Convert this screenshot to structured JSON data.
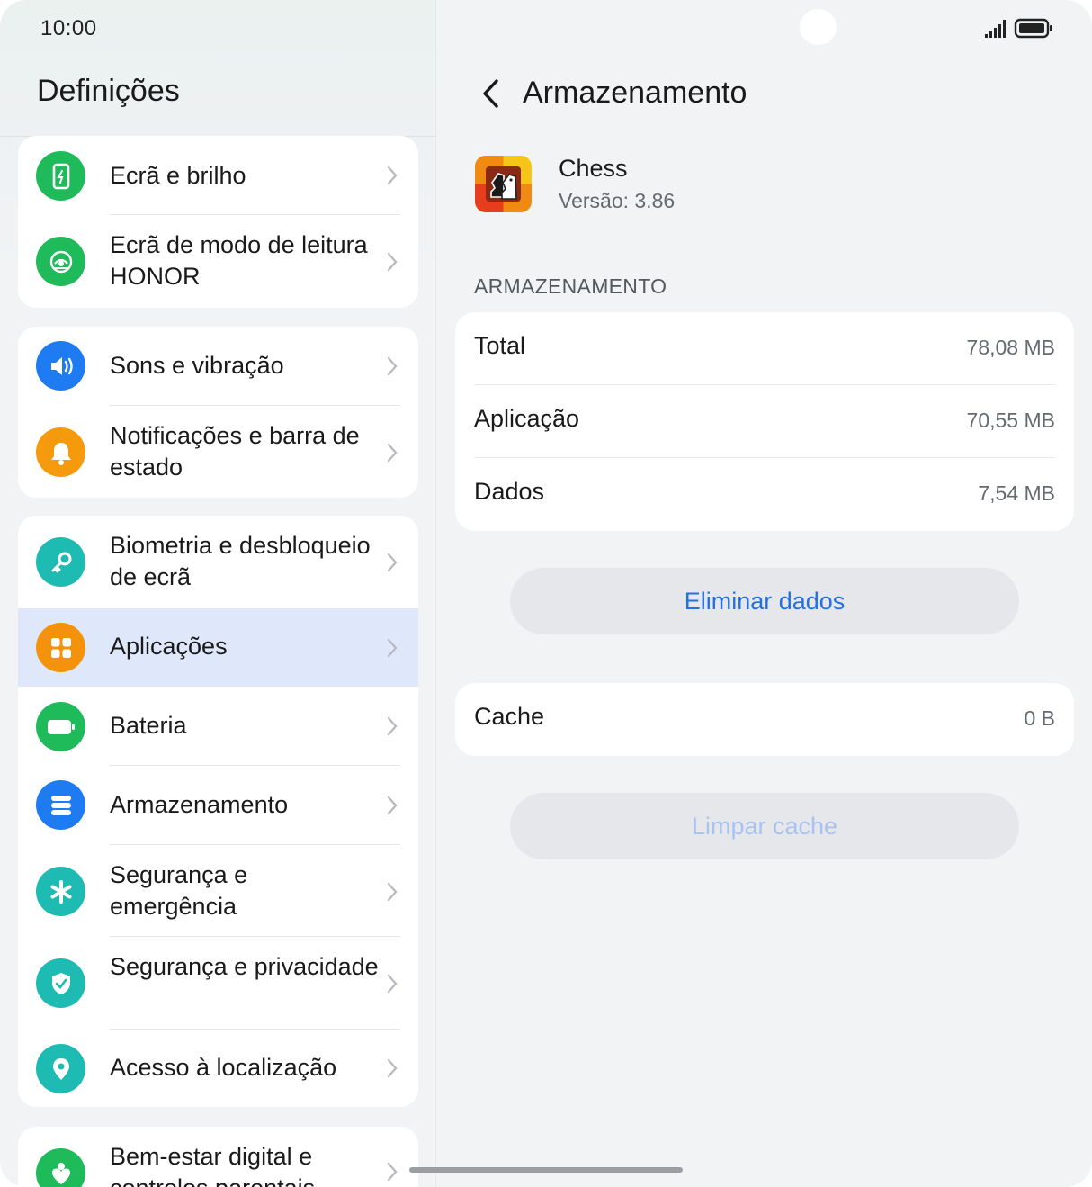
{
  "status_bar": {
    "time": "10:00",
    "signal_icon": "signal-icon",
    "battery_icon": "battery-icon"
  },
  "settings": {
    "title": "Definições",
    "items": [
      {
        "label": "Ecrã e brilho",
        "icon": "display-brightness-icon",
        "color": "#1fba5a"
      },
      {
        "label": "Ecrã de modo de leitura HONOR",
        "icon": "eye-comfort-icon",
        "color": "#1fba5a"
      },
      {
        "label": "Sons e vibração",
        "icon": "speaker-icon",
        "color": "#1f7bf2"
      },
      {
        "label": "Notificações e barra de estado",
        "icon": "bell-icon",
        "color": "#f59a0c"
      },
      {
        "label": "Biometria e desbloqueio de ecrã",
        "icon": "key-icon",
        "color": "#1dbbb2"
      },
      {
        "label": "Aplicações",
        "icon": "apps-grid-icon",
        "color": "#f5920c",
        "selected": true
      },
      {
        "label": "Bateria",
        "icon": "battery-setting-icon",
        "color": "#1fba5a"
      },
      {
        "label": "Armazenamento",
        "icon": "storage-icon",
        "color": "#1f7bf2"
      },
      {
        "label": "Segurança e emergência",
        "icon": "asterisk-icon",
        "color": "#1dbbb2"
      },
      {
        "label": "Segurança e privacidade",
        "icon": "shield-check-icon",
        "color": "#1dbbb2"
      },
      {
        "label": "Acesso à localização",
        "icon": "location-pin-icon",
        "color": "#1dbbb2"
      },
      {
        "label": "Bem-estar digital e controlos parentais",
        "icon": "heart-person-icon",
        "color": "#1fba5a"
      }
    ]
  },
  "detail": {
    "back_icon": "back-arrow-icon",
    "title": "Armazenamento",
    "app": {
      "name": "Chess",
      "version": "Versão: 3.86",
      "icon": "chess-app-icon"
    },
    "section_header": "ARMAZENAMENTO",
    "storage_rows": [
      {
        "label": "Total",
        "value": "78,08 MB"
      },
      {
        "label": "Aplicação",
        "value": "70,55 MB"
      },
      {
        "label": "Dados",
        "value": "7,54 MB"
      }
    ],
    "clear_data_label": "Eliminar dados",
    "cache": {
      "label": "Cache",
      "value": "0 B"
    },
    "clear_cache_label": "Limpar cache",
    "accent_color": "#256fe6"
  }
}
